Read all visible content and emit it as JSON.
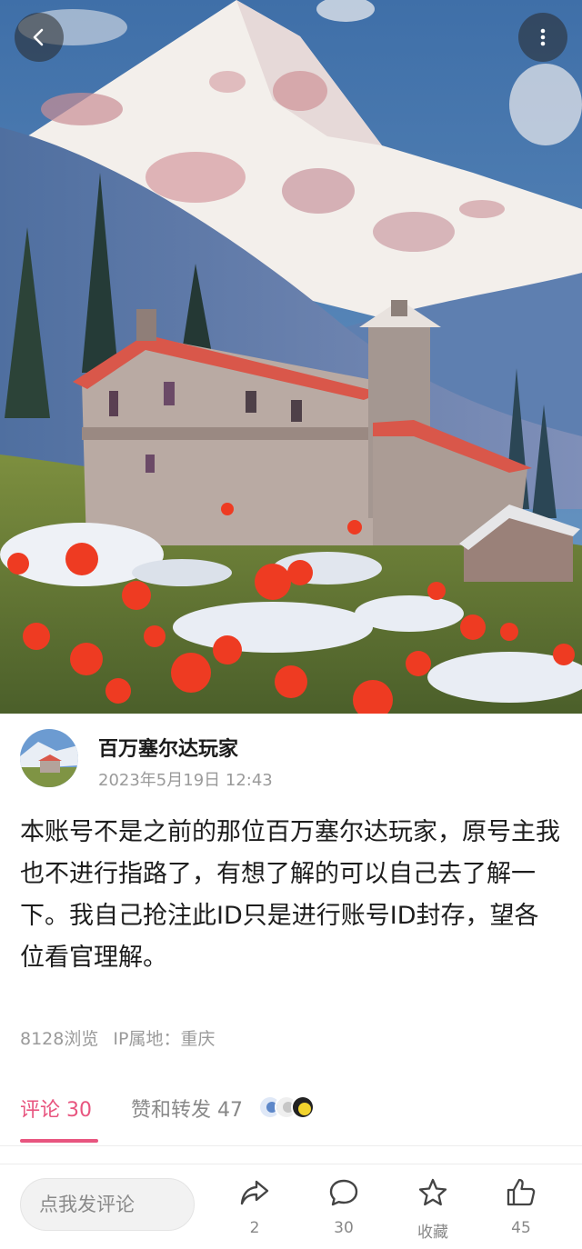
{
  "header": {
    "back_icon": "chevron-left-icon",
    "more_icon": "more-vertical-icon"
  },
  "author": {
    "name": "百万塞尔达玩家",
    "time": "2023年5月19日 12:43"
  },
  "post": {
    "text": "本账号不是之前的那位百万塞尔达玩家，原号主我也不进行指路了，有想了解的可以自己去了解一下。我自己抢注此ID只是进行账号ID封存，望各位看官理解。"
  },
  "meta": {
    "views": "8128浏览",
    "ip": "IP属地：重庆"
  },
  "tabs": {
    "comments": "评论 30",
    "likes": "赞和转发 47"
  },
  "bottom": {
    "comment_placeholder": "点我发评论",
    "share_count": "2",
    "comment_count": "30",
    "favorite_label": "收藏",
    "like_count": "45"
  },
  "colors": {
    "accent": "#e8557f"
  }
}
